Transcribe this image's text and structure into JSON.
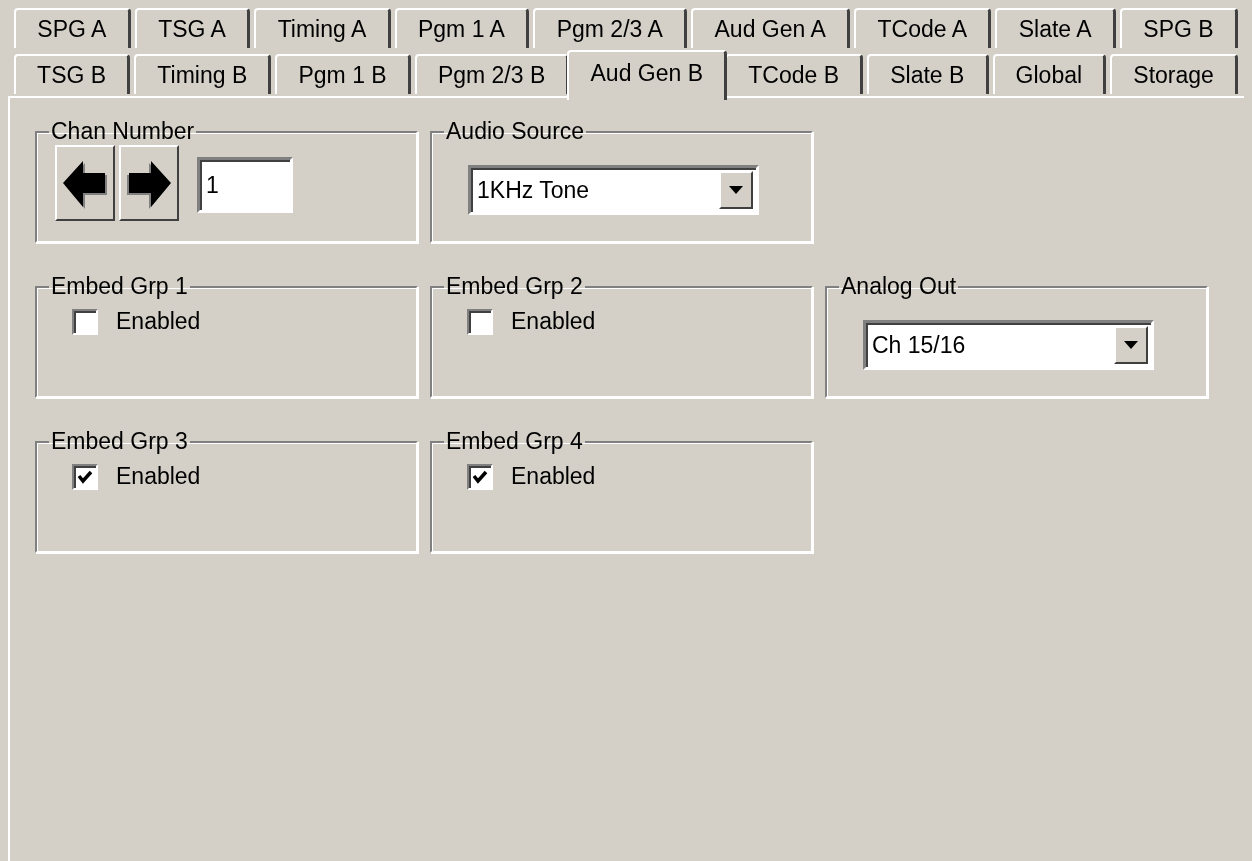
{
  "tab_rows": [
    {
      "tabs": [
        {
          "label": "SPG A",
          "selected": false
        },
        {
          "label": "TSG A",
          "selected": false
        },
        {
          "label": "Timing A",
          "selected": false
        },
        {
          "label": "Pgm 1 A",
          "selected": false
        },
        {
          "label": "Pgm 2/3 A",
          "selected": false
        },
        {
          "label": "Aud Gen A",
          "selected": false
        },
        {
          "label": "TCode A",
          "selected": false
        },
        {
          "label": "Slate A",
          "selected": false
        },
        {
          "label": "SPG B",
          "selected": false
        }
      ]
    },
    {
      "tabs": [
        {
          "label": "TSG B",
          "selected": false
        },
        {
          "label": "Timing B",
          "selected": false
        },
        {
          "label": "Pgm 1 B",
          "selected": false
        },
        {
          "label": "Pgm 2/3 B",
          "selected": false
        },
        {
          "label": "Aud Gen B",
          "selected": true
        },
        {
          "label": "TCode B",
          "selected": false
        },
        {
          "label": "Slate B",
          "selected": false
        },
        {
          "label": "Global",
          "selected": false
        },
        {
          "label": "Storage",
          "selected": false
        }
      ]
    }
  ],
  "groups": [
    {
      "kind": "channel",
      "title": "Chan Number",
      "value": "1"
    },
    {
      "kind": "dropdown",
      "title": "Audio Source",
      "value": "1KHz Tone"
    },
    {
      "kind": "empty"
    },
    {
      "kind": "checkbox",
      "title": "Embed Grp 1",
      "label": "Enabled",
      "checked": false
    },
    {
      "kind": "checkbox",
      "title": "Embed Grp 2",
      "label": "Enabled",
      "checked": false
    },
    {
      "kind": "dropdown",
      "title": "Analog Out",
      "value": "Ch 15/16"
    },
    {
      "kind": "checkbox",
      "title": "Embed Grp 3",
      "label": "Enabled",
      "checked": true
    },
    {
      "kind": "checkbox",
      "title": "Embed Grp 4",
      "label": "Enabled",
      "checked": true
    }
  ]
}
